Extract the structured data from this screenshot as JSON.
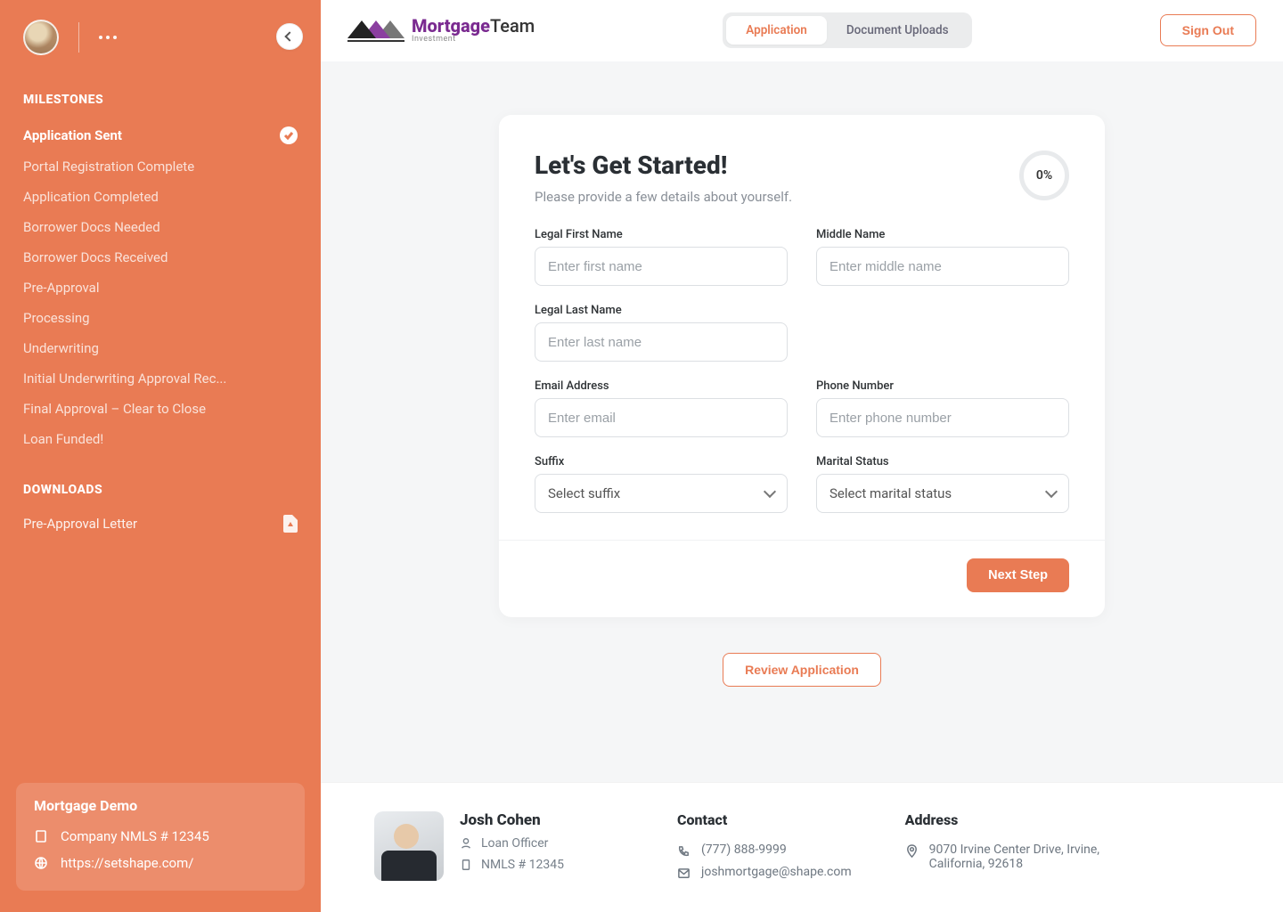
{
  "sidebar": {
    "milestones_title": "MILESTONES",
    "downloads_title": "DOWNLOADS",
    "milestones": [
      {
        "label": "Application Sent",
        "completed": true
      },
      {
        "label": "Portal Registration Complete",
        "completed": false
      },
      {
        "label": "Application Completed",
        "completed": false
      },
      {
        "label": "Borrower Docs Needed",
        "completed": false
      },
      {
        "label": "Borrower Docs Received",
        "completed": false
      },
      {
        "label": "Pre-Approval",
        "completed": false
      },
      {
        "label": "Processing",
        "completed": false
      },
      {
        "label": "Underwriting",
        "completed": false
      },
      {
        "label": "Initial Underwriting Approval Rec...",
        "completed": false
      },
      {
        "label": "Final Approval – Clear to Close",
        "completed": false
      },
      {
        "label": "Loan Funded!",
        "completed": false
      }
    ],
    "downloads": [
      {
        "label": "Pre-Approval Letter"
      }
    ],
    "footer": {
      "company": "Mortgage Demo",
      "nmls": "Company NMLS # 12345",
      "url": "https://setshape.com/"
    }
  },
  "header": {
    "logo_primary": "Mortgage",
    "logo_secondary": "Team",
    "logo_sub": "Investment",
    "tabs": [
      {
        "label": "Application",
        "active": true
      },
      {
        "label": "Document Uploads",
        "active": false
      }
    ],
    "signout": "Sign Out"
  },
  "form": {
    "title": "Let's Get Started!",
    "subtitle": "Please provide a few details about yourself.",
    "progress_label": "0%",
    "fields": {
      "first_name": {
        "label": "Legal First Name",
        "placeholder": "Enter first name"
      },
      "middle_name": {
        "label": "Middle Name",
        "placeholder": "Enter middle name"
      },
      "last_name": {
        "label": "Legal Last Name",
        "placeholder": "Enter last name"
      },
      "email": {
        "label": "Email Address",
        "placeholder": "Enter email"
      },
      "phone": {
        "label": "Phone Number",
        "placeholder": "Enter phone number"
      },
      "suffix": {
        "label": "Suffix",
        "placeholder": "Select suffix"
      },
      "marital": {
        "label": "Marital Status",
        "placeholder": "Select marital status"
      }
    },
    "next_label": "Next Step",
    "review_label": "Review Application"
  },
  "footer": {
    "officer": {
      "name": "Josh Cohen",
      "role": "Loan Officer",
      "nmls": "NMLS # 12345"
    },
    "contact": {
      "title": "Contact",
      "phone": "(777) 888-9999",
      "email": "joshmortgage@shape.com"
    },
    "address": {
      "title": "Address",
      "line": "9070 Irvine Center Drive, Irvine, California, 92618"
    }
  }
}
